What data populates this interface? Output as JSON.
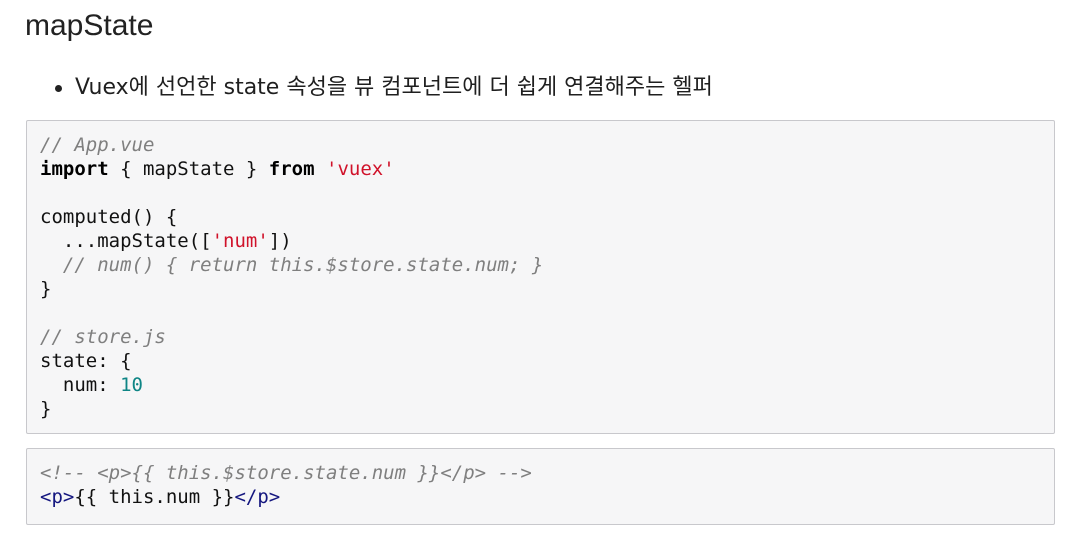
{
  "heading": "mapState",
  "bullets": [
    "Vuex에 선언한 state 속성을 뷰 컴포넌트에 더 쉽게 연결해주는 헬퍼"
  ],
  "code_block_1": {
    "comment_app": "// App.vue",
    "import_kw": "import",
    "import_middle": " { mapState } ",
    "from_kw": "from",
    "import_string": "'vuex'",
    "computed_open": "computed() {",
    "spread_prefix": "  ...mapState([",
    "spread_string": "'num'",
    "spread_suffix": "])",
    "inline_comment": "  // num() { return this.$store.state.num; }",
    "computed_close": "}",
    "comment_store": "// store.js",
    "state_open": "state: {",
    "num_key": "  num: ",
    "num_value": "10",
    "state_close": "}"
  },
  "code_block_2": {
    "comment_line": "<!-- <p>{{ this.$store.state.num }}</p> -->",
    "open_tag": "<p>",
    "content": "{{ this.num }}",
    "close_tag": "</p>"
  }
}
